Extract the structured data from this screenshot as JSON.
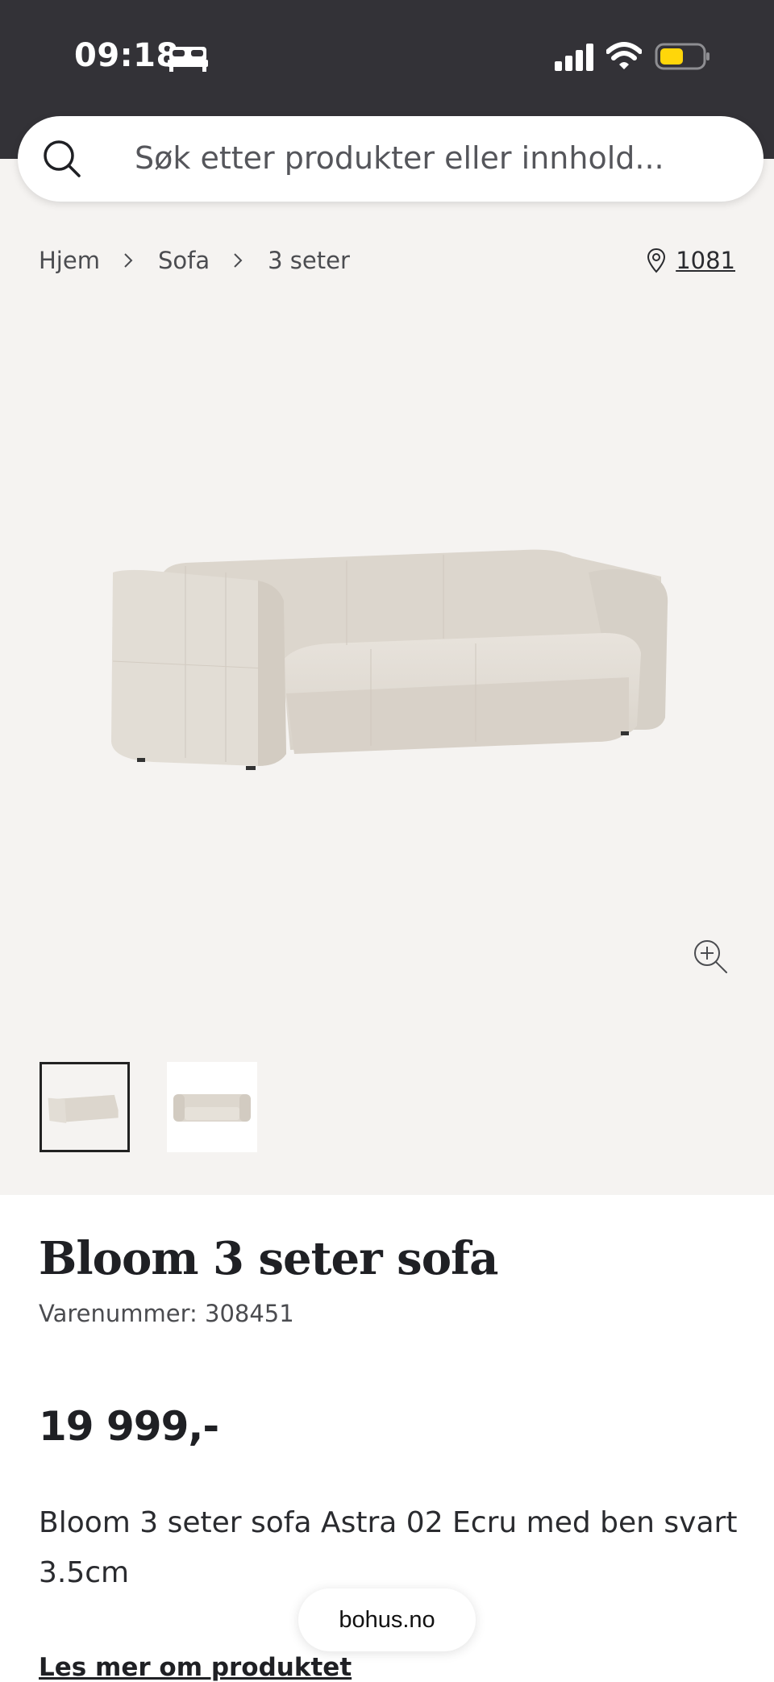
{
  "status_bar": {
    "time": "09:18",
    "icons": [
      "bed-icon",
      "cellular-signal-icon",
      "wifi-icon",
      "battery-icon"
    ],
    "battery_color": "#ffd60a"
  },
  "search": {
    "placeholder": "Søk etter produkter eller innhold..."
  },
  "breadcrumb": {
    "items": [
      "Hjem",
      "Sofa",
      "3 seter"
    ]
  },
  "store": {
    "number": "1081"
  },
  "product": {
    "title": "Bloom 3 seter sofa",
    "sku_label": "Varenummer: 308451",
    "price": "19 999,-",
    "description": "Bloom 3 seter sofa Astra 02 Ecru med ben svart 3.5cm",
    "read_more": "Les mer om produktet"
  },
  "browser": {
    "url": "bohus.no"
  },
  "colors": {
    "status_bar_bg": "#333237",
    "gallery_bg": "#f5f3f1",
    "text": "#1f2024"
  }
}
